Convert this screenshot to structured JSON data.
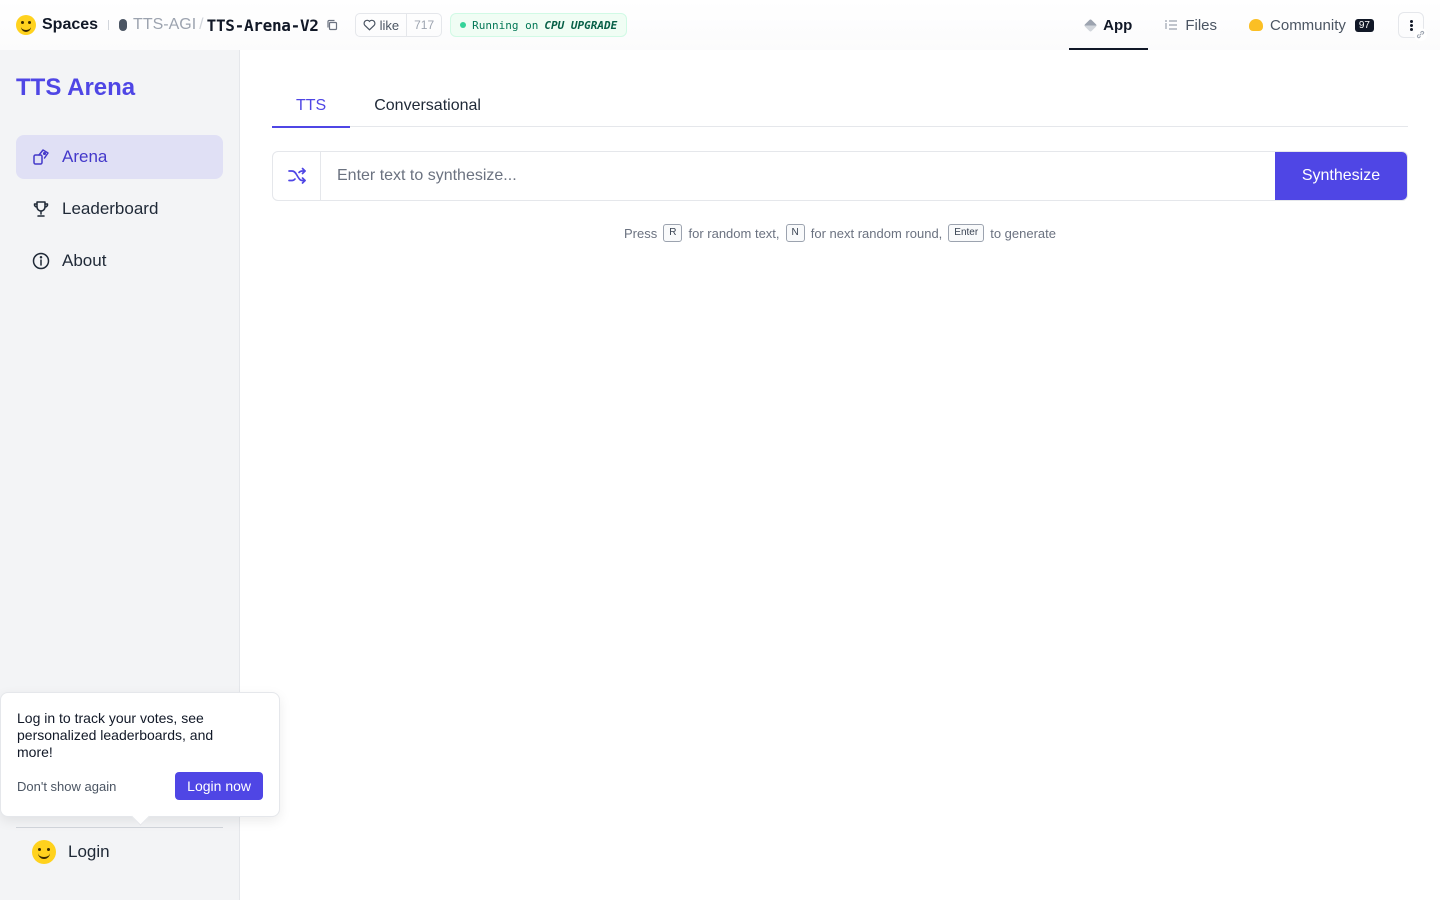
{
  "header": {
    "brand": "Spaces",
    "owner": "TTS-AGI",
    "space_name": "TTS-Arena-V2",
    "like_label": "like",
    "like_count": "717",
    "status_prefix": "Running on",
    "status_hardware": "CPU UPGRADE",
    "tabs": [
      {
        "label": "App",
        "icon": "cube-icon",
        "active": true
      },
      {
        "label": "Files",
        "icon": "files-icon",
        "active": false
      },
      {
        "label": "Community",
        "icon": "community-icon",
        "active": false,
        "count": "97"
      }
    ]
  },
  "sidebar": {
    "title": "TTS Arena",
    "items": [
      {
        "label": "Arena",
        "icon": "arena-icon",
        "active": true
      },
      {
        "label": "Leaderboard",
        "icon": "trophy-icon",
        "active": false
      },
      {
        "label": "About",
        "icon": "info-icon",
        "active": false
      }
    ],
    "login_label": "Login"
  },
  "popup": {
    "message": "Log in to track your votes, see personalized leaderboards, and more!",
    "dismiss_label": "Don't show again",
    "login_label": "Login now"
  },
  "main": {
    "tabs": [
      {
        "label": "TTS",
        "active": true
      },
      {
        "label": "Conversational",
        "active": false
      }
    ],
    "input_placeholder": "Enter text to synthesize...",
    "synthesize_label": "Synthesize",
    "hint": {
      "press": "Press",
      "key_r": "R",
      "random_text": "for random text,",
      "key_n": "N",
      "next_round": "for next random round,",
      "key_enter": "Enter",
      "to_generate": "to generate"
    }
  },
  "colors": {
    "accent": "#4f46e5",
    "sidebar_bg": "#f3f4f6",
    "active_nav_bg": "#e0e0f5",
    "running_green": "#047857"
  }
}
